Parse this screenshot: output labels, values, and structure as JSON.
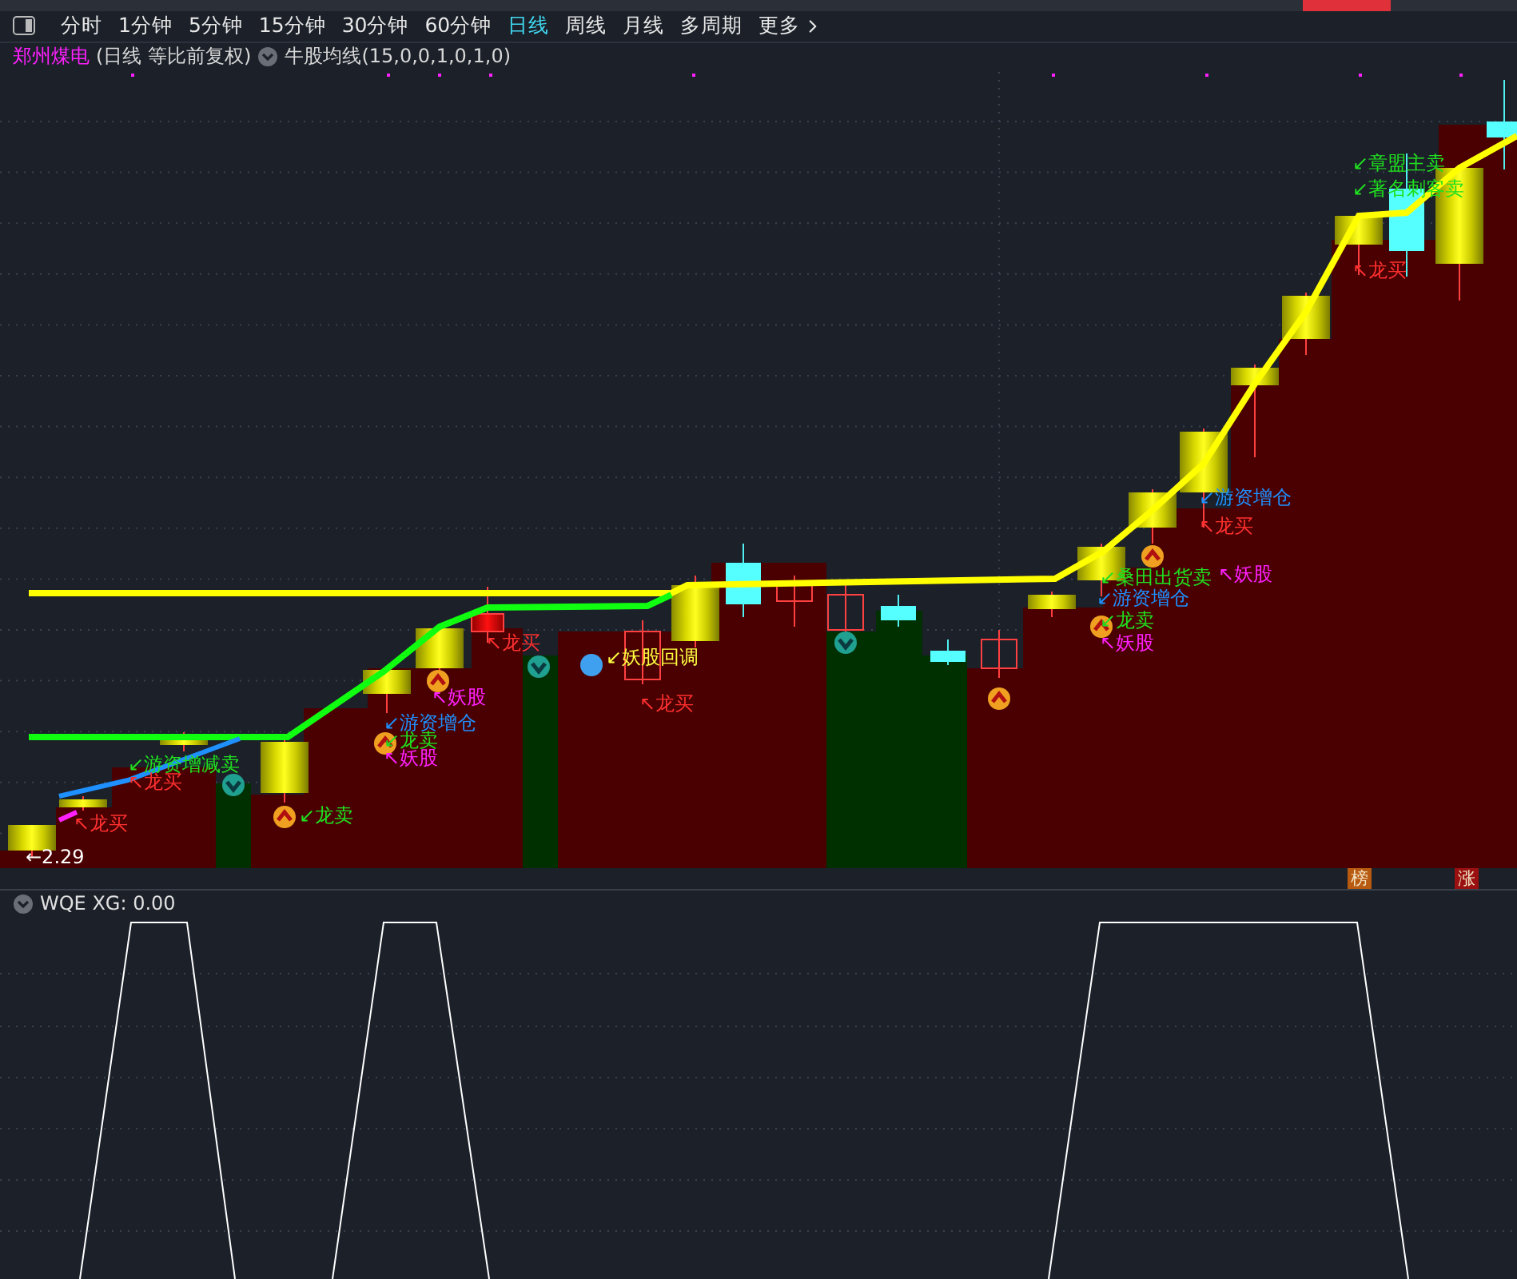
{
  "toolbar": {
    "tabs": [
      {
        "label": "分时",
        "selected": false
      },
      {
        "label": "1分钟",
        "selected": false
      },
      {
        "label": "5分钟",
        "selected": false
      },
      {
        "label": "15分钟",
        "selected": false
      },
      {
        "label": "30分钟",
        "selected": false
      },
      {
        "label": "60分钟",
        "selected": false
      },
      {
        "label": "日线",
        "selected": true
      },
      {
        "label": "周线",
        "selected": false
      },
      {
        "label": "月线",
        "selected": false
      },
      {
        "label": "多周期",
        "selected": false
      }
    ],
    "more": "更多"
  },
  "legend": {
    "symbol": "郑州煤电",
    "mode": "(日线 等比前复权)",
    "indicator": "牛股均线(15,0,0,1,0,1,0)"
  },
  "main_chart": {
    "price_marker": "←2.29",
    "signals": [
      {
        "text": "↖龙买",
        "color": "#ff3030"
      },
      {
        "text": "↖龙买",
        "color": "#ff3030"
      },
      {
        "text": "↙游资增减卖",
        "color": "#20e020"
      },
      {
        "text": "↙龙卖",
        "color": "#20e020"
      },
      {
        "text": "↙游资增仓",
        "color": "#1e90ff"
      },
      {
        "text": "↙龙卖",
        "color": "#20e020"
      },
      {
        "text": "↖妖股",
        "color": "#ff20ff"
      },
      {
        "text": "↖妖股",
        "color": "#ff20ff"
      },
      {
        "text": "↖龙买",
        "color": "#ff3030"
      },
      {
        "text": "↙妖股回调",
        "color": "#ffff40"
      },
      {
        "text": "↖龙买",
        "color": "#ff3030"
      },
      {
        "text": "↙桑田出货卖",
        "color": "#20e020"
      },
      {
        "text": "↖妖股",
        "color": "#ff20ff"
      },
      {
        "text": "↙游资增仓",
        "color": "#1e90ff"
      },
      {
        "text": "↙龙卖",
        "color": "#20e020"
      },
      {
        "text": "↖妖股",
        "color": "#ff20ff"
      },
      {
        "text": "↙游资增仓",
        "color": "#1e90ff"
      },
      {
        "text": "↖龙买",
        "color": "#ff3030"
      },
      {
        "text": "↙章盟主卖",
        "color": "#20e020"
      },
      {
        "text": "↙著名刺客卖",
        "color": "#20e020"
      },
      {
        "text": "↖龙买",
        "color": "#ff3030"
      }
    ]
  },
  "badges": [
    {
      "text": "榜",
      "color": "#b85a10"
    },
    {
      "text": "涨",
      "color": "#9a1010"
    }
  ],
  "sub_chart": {
    "title": "WQE  XG: 0.00"
  }
}
